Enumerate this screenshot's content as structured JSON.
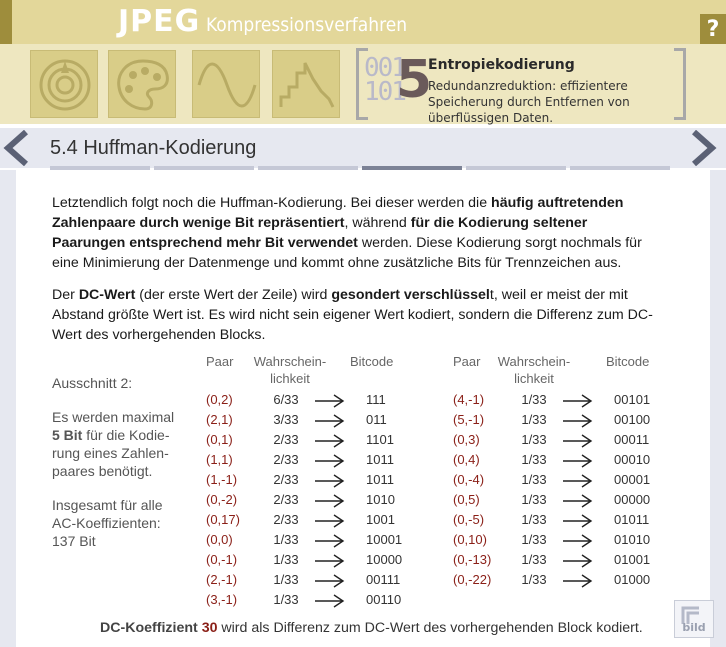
{
  "header": {
    "title": "JPEG",
    "subtitle": "Kompressionsverfahren",
    "help_label": "?",
    "step_number": "5",
    "step_binary": "001\n101",
    "step_title": "Entropiekodierung",
    "step_description": "Redundanzreduktion: effizientere Speicherung durch Entfernen von überflüssigen Daten.",
    "step_icons": [
      "spiral-icon",
      "palette-icon",
      "sine-wave-icon",
      "zigzag-icon"
    ]
  },
  "section": {
    "title": "5.4  Huffman-Kodierung"
  },
  "paragraph1": {
    "p1": "Letztendlich folgt noch die Huffman-Kodierung. Bei dieser werden die ",
    "b1": "häufig auftretenden Zahlenpaare durch wenige Bit repräsentiert",
    "p2": ", während ",
    "b2": "für die Kodierung seltener Paarungen entsprechend mehr Bit verwendet",
    "p3": " werden. Diese Kodierung sorgt nochmals für eine Minimierung der Datenmenge und kommt ohne zusätzliche Bits für Trennzeichen aus."
  },
  "paragraph2": {
    "p1": "Der ",
    "b1": "DC-Wert",
    "p2": " (der erste Wert der Zeile) wird ",
    "b2": "gesondert verschlüssel",
    "p3": "t, weil er meist der mit Abstand größte Wert ist. Es wird nicht sein eigener Wert kodiert, sondern die Differenz zum DC-Wert des vorhergehenden Blocks."
  },
  "side": {
    "heading": "Ausschnitt 2:",
    "note1_a": "Es werden maximal",
    "note1_b": "5 Bit",
    "note1_c": " für die Kodie-",
    "note1_d": "rung eines Zahlen-",
    "note1_e": "paares benötigt.",
    "note2_a": "Insgesamt für alle",
    "note2_b": "AC-Koeffizienten:",
    "note2_c": "137 Bit"
  },
  "table_headers": {
    "pair": "Paar",
    "prob_1": "Wahrschein-",
    "prob_2": "lichkeit",
    "code": "Bitcode"
  },
  "table_left": [
    {
      "pair": "(0,2)",
      "prob": "6/33",
      "code": "111"
    },
    {
      "pair": "(2,1)",
      "prob": "3/33",
      "code": "011"
    },
    {
      "pair": "(0,1)",
      "prob": "2/33",
      "code": "1101"
    },
    {
      "pair": "(1,1)",
      "prob": "2/33",
      "code": "1011"
    },
    {
      "pair": "(1,-1)",
      "prob": "2/33",
      "code": "1011"
    },
    {
      "pair": "(0,-2)",
      "prob": "2/33",
      "code": "1010"
    },
    {
      "pair": "(0,17)",
      "prob": "2/33",
      "code": "1001"
    },
    {
      "pair": "(0,0)",
      "prob": "1/33",
      "code": "10001"
    },
    {
      "pair": "(0,-1)",
      "prob": "1/33",
      "code": "10000"
    },
    {
      "pair": "(2,-1)",
      "prob": "1/33",
      "code": "00111"
    },
    {
      "pair": "(3,-1)",
      "prob": "1/33",
      "code": "00110"
    }
  ],
  "table_right": [
    {
      "pair": "(4,-1)",
      "prob": "1/33",
      "code": "00101"
    },
    {
      "pair": "(5,-1)",
      "prob": "1/33",
      "code": "00100"
    },
    {
      "pair": "(0,3)",
      "prob": "1/33",
      "code": "00011"
    },
    {
      "pair": "(0,4)",
      "prob": "1/33",
      "code": "00010"
    },
    {
      "pair": "(0,-4)",
      "prob": "1/33",
      "code": "00001"
    },
    {
      "pair": "(0,5)",
      "prob": "1/33",
      "code": "00000"
    },
    {
      "pair": "(0,-5)",
      "prob": "1/33",
      "code": "01011"
    },
    {
      "pair": "(0,10)",
      "prob": "1/33",
      "code": "01010"
    },
    {
      "pair": "(0,-13)",
      "prob": "1/33",
      "code": "01001"
    },
    {
      "pair": "(0,-22)",
      "prob": "1/33",
      "code": "01000"
    }
  ],
  "footer": {
    "label": "DC-Koeffizient",
    "value": "30",
    "text": " wird als Differenz zum DC-Wert des vorhergehenden Block kodiert."
  },
  "bild_button": {
    "label": "bild"
  },
  "colors": {
    "header_bg": "#e3d79a",
    "accent_dark": "#9e8d3c",
    "pair_red": "#8a1f17",
    "section_bg": "#e6e8f0"
  }
}
